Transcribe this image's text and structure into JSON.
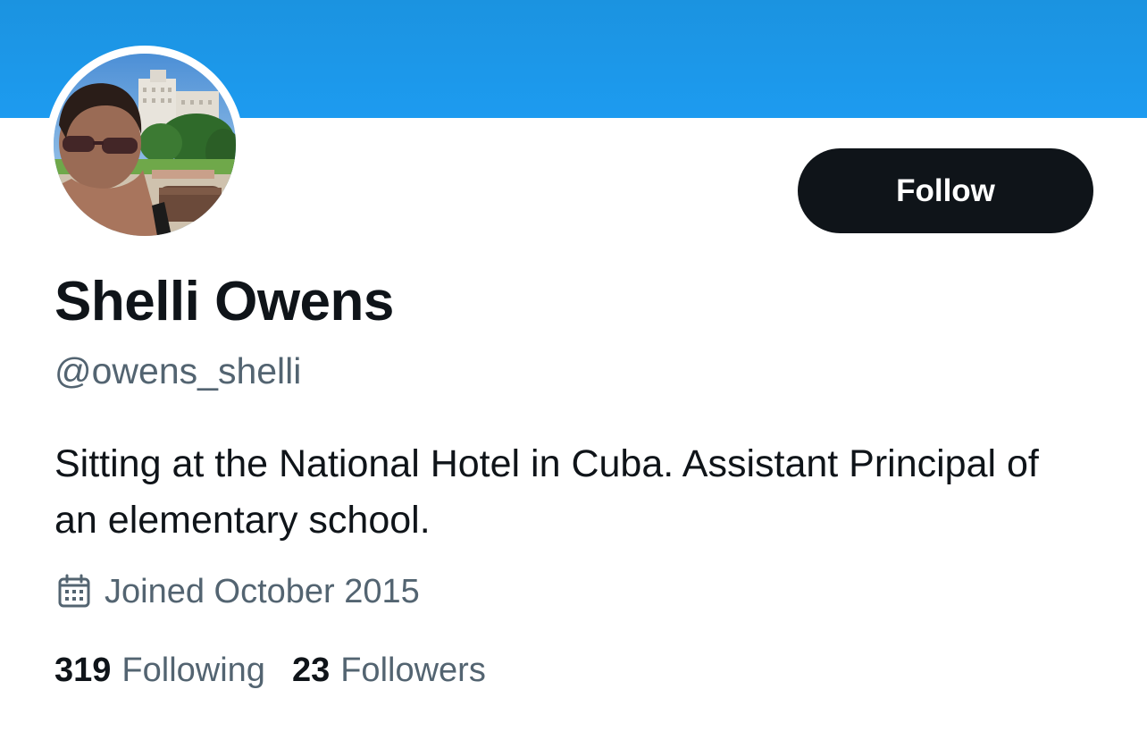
{
  "profile": {
    "display_name": "Shelli Owens",
    "handle": "@owens_shelli",
    "bio": "Sitting at the National Hotel in Cuba. Assistant Principal of an elementary school.",
    "joined": "Joined October 2015"
  },
  "actions": {
    "follow_label": "Follow"
  },
  "stats": {
    "following_count": "319",
    "following_label": "Following",
    "followers_count": "23",
    "followers_label": "Followers"
  },
  "icons": {
    "calendar": "calendar-icon"
  },
  "colors": {
    "banner": "#1d9bf0",
    "button_bg": "#0f1419",
    "primary_text": "#0f1419",
    "secondary_text": "#536471"
  }
}
